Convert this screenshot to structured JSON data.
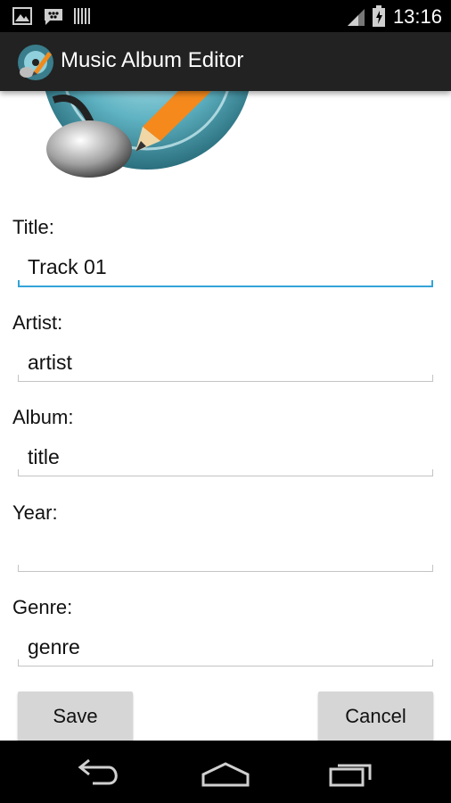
{
  "status_bar": {
    "time": "13:16",
    "icons": [
      "gallery-icon",
      "bbm-icon",
      "barcode-icon",
      "signal-icon",
      "battery-icon"
    ]
  },
  "action_bar": {
    "title": "Music Album Editor",
    "icon": "music-edit-icon"
  },
  "form": {
    "title_label": "Title:",
    "title_value": "Track 01",
    "artist_label": "Artist:",
    "artist_value": "artist",
    "album_label": "Album:",
    "album_value": "title",
    "year_label": "Year:",
    "year_value": "",
    "genre_label": "Genre:",
    "genre_value": "genre"
  },
  "buttons": {
    "save_label": "Save",
    "cancel_label": "Cancel"
  },
  "nav_bar": {
    "icons": [
      "back-icon",
      "home-icon",
      "recents-icon"
    ]
  },
  "colors": {
    "focus_accent": "#33a3d9",
    "action_bar_bg": "#222222",
    "button_bg": "#d6d6d6"
  }
}
